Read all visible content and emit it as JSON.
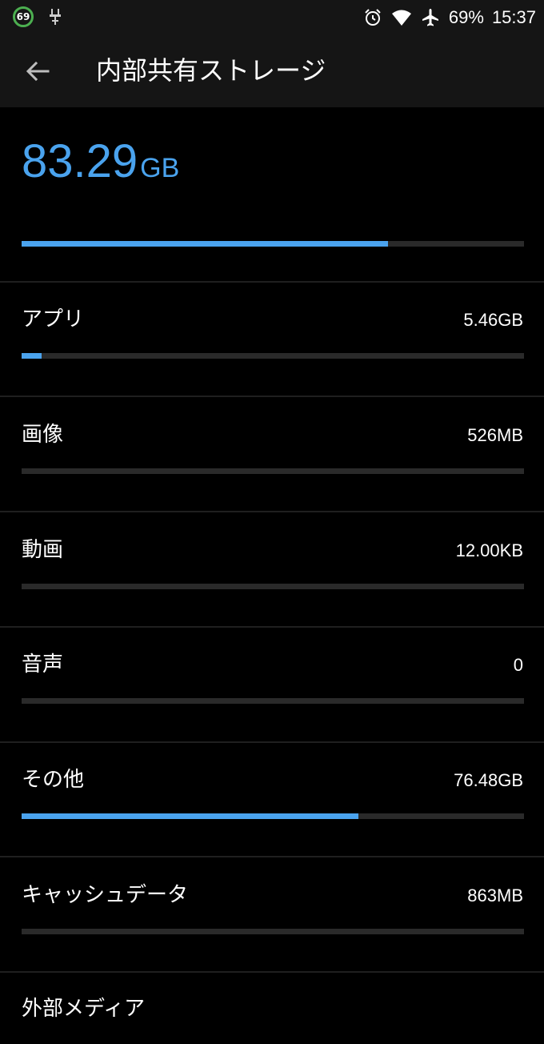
{
  "status_bar": {
    "badge": "69",
    "battery": "69%",
    "time": "15:37",
    "icons": [
      "usb-debug-icon",
      "alarm-icon",
      "wifi-icon",
      "airplane-icon"
    ]
  },
  "toolbar": {
    "back_icon": "arrow-left-icon",
    "title": "内部共有ストレージ"
  },
  "total": {
    "value": "83.29",
    "unit": "GB",
    "used_fraction": 0.73
  },
  "categories": [
    {
      "label": "アプリ",
      "size": "5.46GB",
      "fraction": 0.04
    },
    {
      "label": "画像",
      "size": "526MB",
      "fraction": 0.0
    },
    {
      "label": "動画",
      "size": "12.00KB",
      "fraction": 0.0
    },
    {
      "label": "音声",
      "size": "0",
      "fraction": 0.0
    },
    {
      "label": "その他",
      "size": "76.48GB",
      "fraction": 0.67
    },
    {
      "label": "キャッシュデータ",
      "size": "863MB",
      "fraction": 0.0
    }
  ],
  "external": {
    "label": "外部メディア"
  },
  "colors": {
    "accent": "#4aa3ee",
    "background": "#000000",
    "toolbar": "#151515",
    "track": "#2a2a2a"
  }
}
